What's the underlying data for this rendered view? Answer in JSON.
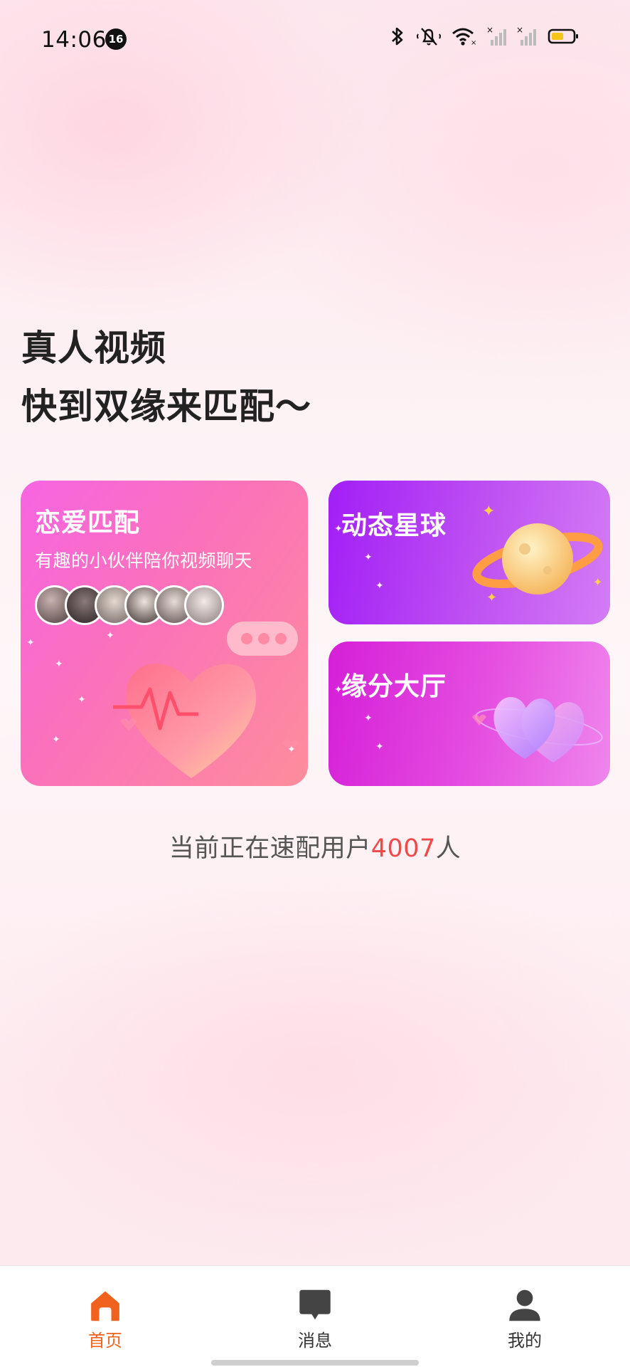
{
  "status_bar": {
    "time": "14:06",
    "notification_count": "16",
    "icons": [
      "bluetooth-icon",
      "mute-icon",
      "wifi-icon",
      "signal-1-icon",
      "signal-2-icon",
      "battery-icon"
    ]
  },
  "headline": {
    "line1": "真人视频",
    "line2": "快到双缘来匹配～"
  },
  "cards": {
    "love_match": {
      "title": "恋爱匹配",
      "subtitle": "有趣的小伙伴陪你视频聊天",
      "colors": [
        "#f765e2",
        "#fd8d9c"
      ]
    },
    "planet": {
      "title": "动态星球",
      "colors": [
        "#a21ef6",
        "#d47cf5"
      ]
    },
    "hall": {
      "title": "缘分大厅",
      "colors": [
        "#d51fd8",
        "#ef86ec"
      ]
    }
  },
  "online": {
    "prefix": "当前正在速配用户",
    "count": "4007",
    "suffix": "人"
  },
  "nav": {
    "items": [
      {
        "label": "首页",
        "icon": "home-icon",
        "active": true
      },
      {
        "label": "消息",
        "icon": "message-icon",
        "active": false
      },
      {
        "label": "我的",
        "icon": "profile-icon",
        "active": false
      }
    ],
    "active_color": "#f2621f"
  }
}
